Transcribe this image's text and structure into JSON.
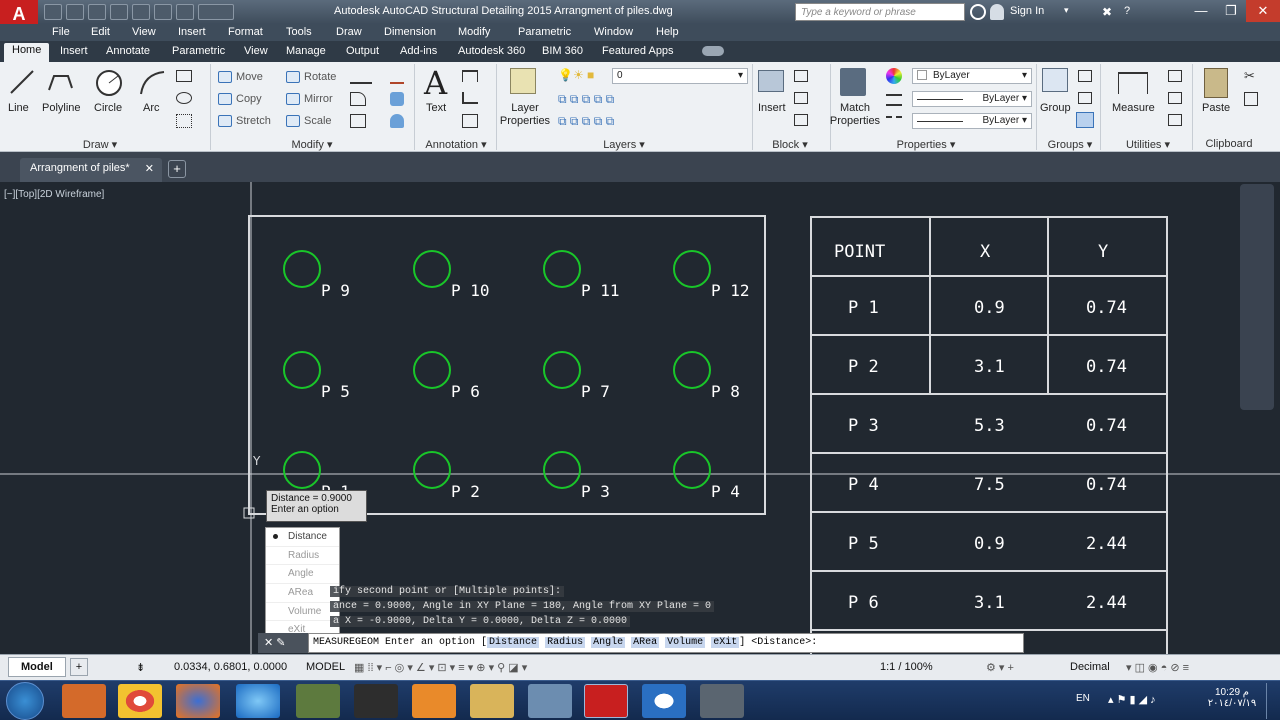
{
  "app": {
    "logo": "A",
    "title": "Autodesk AutoCAD Structural Detailing 2015    Arrangment of piles.dwg"
  },
  "search": {
    "placeholder": "Type a keyword or phrase"
  },
  "account": {
    "signin": "Sign In"
  },
  "menu": [
    "File",
    "Edit",
    "View",
    "Insert",
    "Format",
    "Tools",
    "Draw",
    "Dimension",
    "Modify",
    "Parametric",
    "Window",
    "Help"
  ],
  "ribbon_tabs": [
    "Home",
    "Insert",
    "Annotate",
    "Parametric",
    "View",
    "Manage",
    "Output",
    "Add-ins",
    "Autodesk 360",
    "BIM 360",
    "Featured Apps"
  ],
  "ribbon": {
    "draw": {
      "title": "Draw",
      "buttons": [
        "Line",
        "Polyline",
        "Circle",
        "Arc"
      ]
    },
    "modify": {
      "title": "Modify",
      "rows": [
        [
          "Move",
          "Rotate"
        ],
        [
          "Copy",
          "Mirror"
        ],
        [
          "Stretch",
          "Scale"
        ]
      ]
    },
    "annotation": {
      "title": "Annotation",
      "text": "Text"
    },
    "layers": {
      "title": "Layers",
      "button": "Layer Properties",
      "current_layer": "0"
    },
    "block": {
      "title": "Block",
      "insert": "Insert"
    },
    "properties": {
      "title": "Properties",
      "match": "Match Properties",
      "color": "ByLayer",
      "linetype": "ByLayer",
      "lineweight": "ByLayer"
    },
    "groups": {
      "title": "Groups",
      "group": "Group"
    },
    "utilities": {
      "title": "Utilities",
      "measure": "Measure"
    },
    "clipboard": {
      "title": "Clipboard",
      "paste": "Paste"
    }
  },
  "doc_tab": "Arrangment of piles*",
  "view_label": "[−][Top][2D Wireframe]",
  "piles": [
    {
      "label": "P 9"
    },
    {
      "label": "P 10"
    },
    {
      "label": "P 11"
    },
    {
      "label": "P 12"
    },
    {
      "label": "P 5"
    },
    {
      "label": "P 6"
    },
    {
      "label": "P 7"
    },
    {
      "label": "P 8"
    },
    {
      "label": "P 1"
    },
    {
      "label": "P 2"
    },
    {
      "label": "P 3"
    },
    {
      "label": "P 4"
    }
  ],
  "table": {
    "headers": [
      "POINT",
      "X",
      "Y"
    ],
    "rows": [
      [
        "P 1",
        "0.9",
        "0.74"
      ],
      [
        "P 2",
        "3.1",
        "0.74"
      ],
      [
        "P 3",
        "5.3",
        "0.74"
      ],
      [
        "P 4",
        "7.5",
        "0.74"
      ],
      [
        "P 5",
        "0.9",
        "2.44"
      ],
      [
        "P 6",
        "3.1",
        "2.44"
      ]
    ]
  },
  "tooltip": {
    "line1": "Distance = 0.9000",
    "line2": "Enter an option"
  },
  "context_menu": {
    "items": [
      "Distance",
      "Radius",
      "Angle",
      "ARea",
      "Volume",
      "eXit"
    ],
    "selected": "Distance"
  },
  "command_history": [
    "ify second point or [Multiple points]:",
    "ance = 0.9000,  Angle in XY Plane = 180,  Angle from XY Plane = 0",
    "a X = -0.9000,  Delta Y = 0.0000,   Delta Z = 0.0000"
  ],
  "command": {
    "prefix": "MEASUREGEOM Enter an option [",
    "options": [
      "Distance",
      "Radius",
      "Angle",
      "ARea",
      "Volume",
      "eXit"
    ],
    "suffix": "] <Distance>:"
  },
  "status": {
    "model_tab": "Model",
    "coords": "0.0334, 0.6801, 0.0000",
    "mode": "MODEL",
    "scale": "1:1 / 100%",
    "units": "Decimal"
  },
  "taskbar": {
    "lang": "EN",
    "time": "10:29 م",
    "date": "٢٠١٤/٠٧/١٩"
  },
  "colors": {
    "accent": "#c81f1f",
    "pile": "#19c629",
    "canvas": "#212830"
  }
}
